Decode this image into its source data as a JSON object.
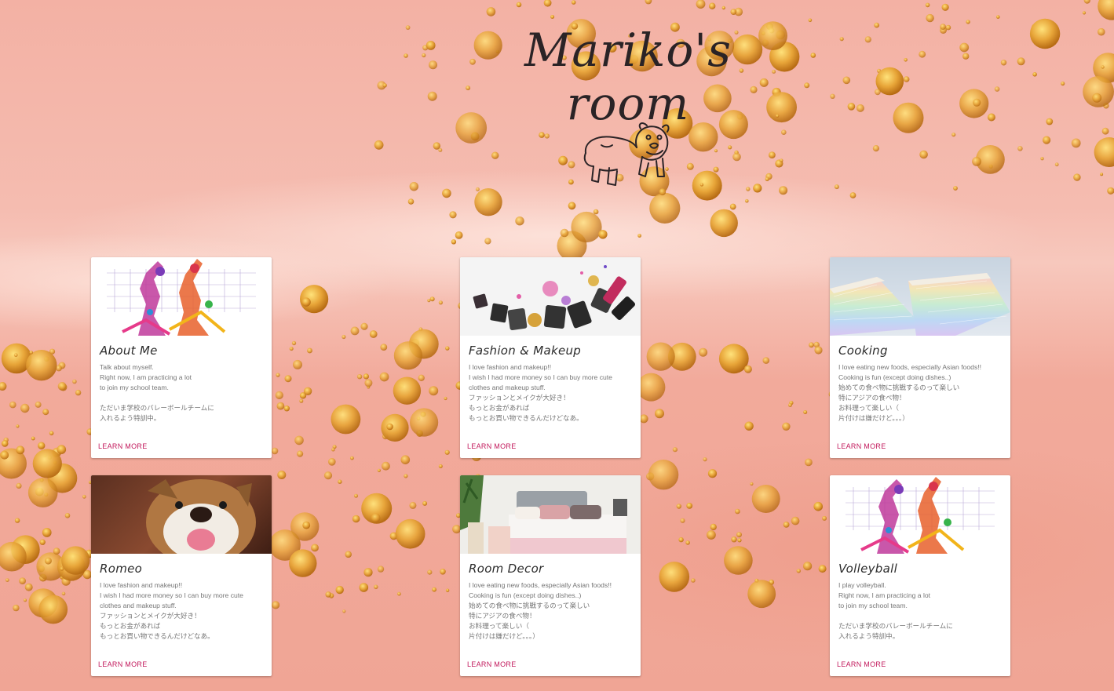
{
  "site": {
    "title": "Mariko's room"
  },
  "cards": [
    {
      "id": "about",
      "title": "About Me",
      "text": "Talk about myself.\nRight now, I am practicing a lot\nto join my school team.\n\nただいま学校のバレーボールチームに\n入れるよう特訓中。",
      "action": "LEARN MORE",
      "media": "volleyball-players"
    },
    {
      "id": "fashion",
      "title": "Fashion & Makeup",
      "text": "I love fashion and makeup!!\nI wish I had more money so I can buy more cute clothes and makeup stuff.\nファッションとメイクが大好き！\nもっとお金があれば\nもっとお買い物できるんだけどなあ。",
      "action": "LEARN MORE",
      "media": "makeup-items"
    },
    {
      "id": "cooking",
      "title": "Cooking",
      "text": "I love eating new foods, especially Asian foods!!\nCooking is fun (except doing dishes..)\n始めての食べ物に挑戦するのって楽しい\n特にアジアの食べ物！\nお料理って楽しい（\n片付けは嫌だけど。。。）",
      "action": "LEARN MORE",
      "media": "rainbow-crepe-cake"
    },
    {
      "id": "romeo",
      "title": "Romeo",
      "text": "I love fashion and makeup!!\nI wish I had more money so I can buy more cute clothes and makeup stuff.\nファッションとメイクが大好き！\nもっとお金があれば\nもっとお買い物できるんだけどなあ。",
      "action": "LEARN MORE",
      "media": "bulldog-photo"
    },
    {
      "id": "room",
      "title": "Room Decor",
      "text": "I love eating new foods, especially Asian foods!!\nCooking is fun (except doing dishes..)\n始めての食べ物に挑戦するのって楽しい\n特にアジアの食べ物！\nお料理って楽しい（\n片付けは嫌だけど。。。）",
      "action": "LEARN MORE",
      "media": "bedroom-photo"
    },
    {
      "id": "volleyball",
      "title": "Volleyball",
      "text": "I play volleyball.\nRight now, I am practicing a lot\nto join my school team.\n\nただいま学校のバレーボールチームに\n入れるよう特訓中。",
      "action": "LEARN MORE",
      "media": "volleyball-players"
    }
  ],
  "colors": {
    "accent": "#c2185b",
    "background": "#f3b1a4",
    "glitter": "#e8a83a"
  }
}
